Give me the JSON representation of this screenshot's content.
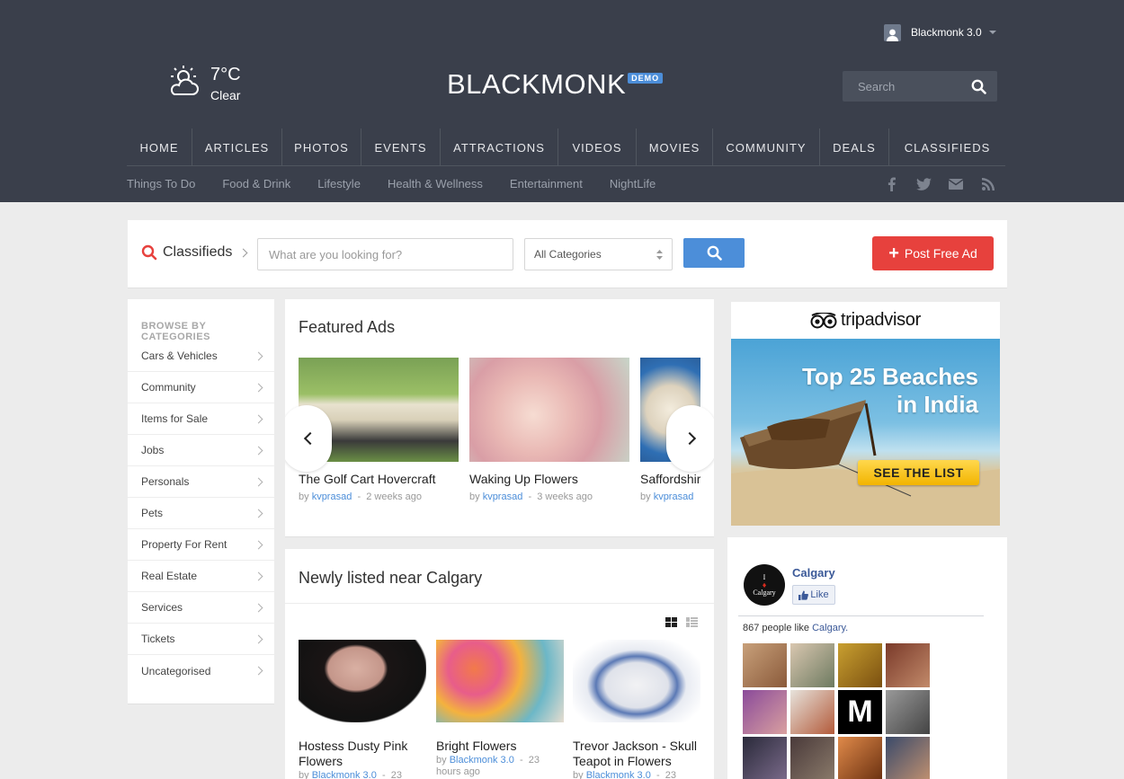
{
  "header": {
    "user": {
      "name": "Blackmonk 3.0"
    },
    "weather": {
      "temp": "7°C",
      "condition": "Clear"
    },
    "logo": {
      "text": "BLACKMONK",
      "badge": "DEMO"
    },
    "search": {
      "placeholder": "Search"
    },
    "nav": [
      "HOME",
      "ARTICLES",
      "PHOTOS",
      "EVENTS",
      "ATTRACTIONS",
      "VIDEOS",
      "MOVIES",
      "COMMUNITY",
      "DEALS",
      "CLASSIFIEDS"
    ],
    "subnav": [
      "Things To Do",
      "Food & Drink",
      "Lifestyle",
      "Health & Wellness",
      "Entertainment",
      "NightLife"
    ],
    "social": [
      "facebook-icon",
      "twitter-icon",
      "mail-icon",
      "rss-icon"
    ]
  },
  "classifieds": {
    "title": "Classifieds",
    "search_placeholder": "What are you looking for?",
    "category_select": "All Categories",
    "post_button": "Post Free Ad"
  },
  "categories": {
    "heading": "BROWSE BY CATEGORIES",
    "items": [
      "Cars & Vehicles",
      "Community",
      "Items for Sale",
      "Jobs",
      "Personals",
      "Pets",
      "Property For Rent",
      "Real Estate",
      "Services",
      "Tickets",
      "Uncategorised"
    ]
  },
  "featured": {
    "title": "Featured Ads",
    "items": [
      {
        "title": "The Golf Cart Hovercraft",
        "by": "by",
        "author": "kvprasad",
        "sep": "-",
        "time": "2 weeks ago"
      },
      {
        "title": "Waking Up Flowers",
        "by": "by",
        "author": "kvprasad",
        "sep": "-",
        "time": "3 weeks ago"
      },
      {
        "title": "Saffordshire",
        "by": "by",
        "author": "kvprasad",
        "sep": "",
        "time": ""
      }
    ]
  },
  "newly": {
    "title": "Newly listed near Calgary",
    "items": [
      {
        "title": "Hostess Dusty Pink Flowers",
        "by": "by",
        "author": "Blackmonk 3.0",
        "sep": "-",
        "time": "23"
      },
      {
        "title": "Bright Flowers",
        "by": "by",
        "author": "Blackmonk 3.0",
        "sep": "-",
        "time": "23"
      },
      {
        "title": "Trevor Jackson - Skull Teapot in Flowers",
        "by": "by",
        "author": "Blackmonk 3.0",
        "sep": "-",
        "time": "23"
      }
    ],
    "extra_time": "hours ago"
  },
  "ad": {
    "brand": "tripadvisor",
    "headline_1": "Top 25 Beaches",
    "headline_2": "in India",
    "button": "SEE THE LIST"
  },
  "facebook": {
    "page_name": "Calgary",
    "logo_text_1": "I",
    "logo_text_2": "Calgary",
    "like_label": "Like",
    "count_text": "867 people like",
    "count_link": "Calgary."
  },
  "colors": {
    "header_bg": "#3a3f4b",
    "accent_blue": "#4c8ed9",
    "post_red": "#e7413d",
    "facebook_blue": "#3b5998"
  }
}
